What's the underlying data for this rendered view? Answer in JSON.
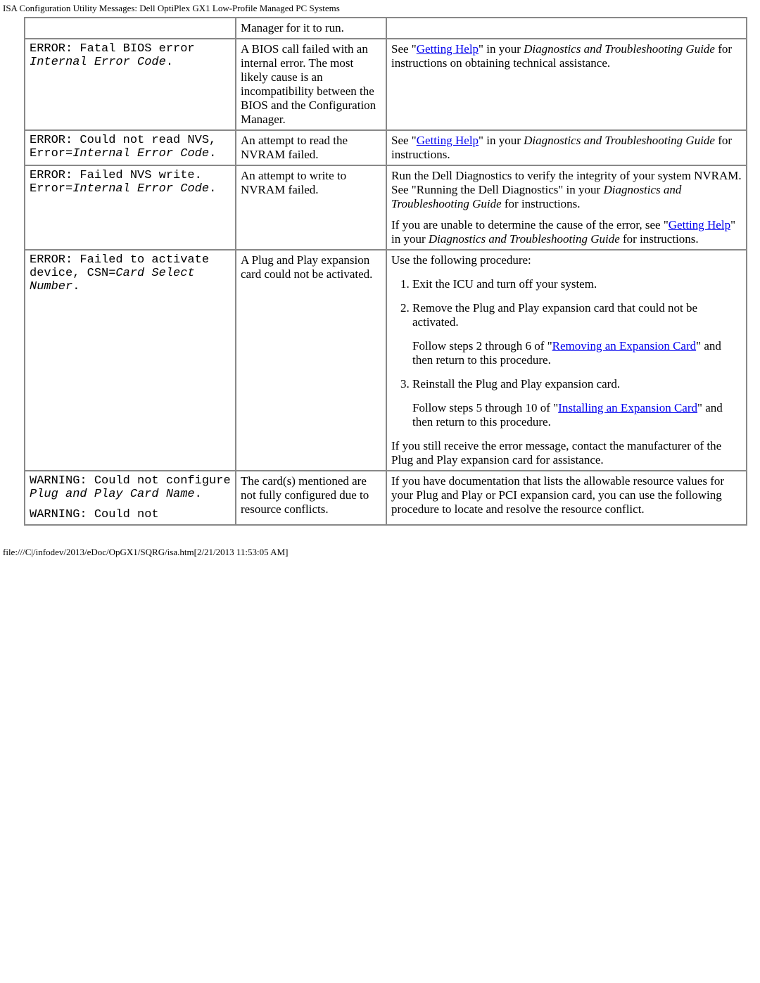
{
  "page_title": "ISA Configuration Utility Messages: Dell OptiPlex GX1 Low-Profile Managed PC Systems",
  "footer": "file:///C|/infodev/2013/eDoc/OpGX1/SQRG/isa.htm[2/21/2013 11:53:05 AM]",
  "diag_guide": "Diagnostics and Troubleshooting Guide",
  "links": {
    "getting_help": "Getting Help",
    "removing_card": "Removing an Expansion Card",
    "installing_card": "Installing an Expansion Card"
  },
  "row0": {
    "cause": "Manager for it to run."
  },
  "row1": {
    "msg_a": "ERROR: Fatal BIOS error ",
    "msg_b": "Internal Error Code",
    "msg_c": ".",
    "cause": "A BIOS call failed with an internal error. The most likely cause is an incompatibility between the BIOS and the Configuration Manager.",
    "action_a": "See \"",
    "action_b": "\" in your ",
    "action_c": " for instructions on obtaining technical assistance."
  },
  "row2": {
    "msg_a": "ERROR: Could not read NVS, Error=",
    "msg_b": "Internal Error Code",
    "msg_c": ".",
    "cause": "An attempt to read the NVRAM failed.",
    "action_a": "See \"",
    "action_b": "\" in your ",
    "action_c": " for instructions."
  },
  "row3": {
    "msg_a": "ERROR: Failed NVS write. Error=",
    "msg_b": "Internal Error Code",
    "msg_c": ".",
    "cause": "An attempt to write to NVRAM failed.",
    "p1_a": "Run the Dell Diagnostics to verify the integrity of your system NVRAM. See \"Running the Dell Diagnostics\" in your ",
    "p1_b": " for instructions.",
    "p2_a": "If you are unable to determine the cause of the error, see \"",
    "p2_b": "\" in your ",
    "p2_c": " for instructions."
  },
  "row4": {
    "msg_a": "ERROR: Failed to activate device, CSN=",
    "msg_b": "Card Select Number",
    "msg_c": ".",
    "cause": "A Plug and Play expansion card could not be activated.",
    "intro": "Use the following procedure:",
    "li1": "Exit the ICU and turn off your system.",
    "li2": "Remove the Plug and Play expansion card that could not be activated.",
    "li2_sub_a": "Follow steps 2 through 6 of \"",
    "li2_sub_b": "\" and then return to this procedure.",
    "li3": "Reinstall the Plug and Play expansion card.",
    "li3_sub_a": "Follow steps 5 through 10 of \"",
    "li3_sub_b": "\" and then return to this procedure.",
    "outro": "If you still receive the error message, contact the manufacturer of the Plug and Play expansion card for assistance."
  },
  "row5": {
    "msg1_a": "WARNING: Could not configure ",
    "msg1_b": "Plug and Play Card Name",
    "msg1_c": ".",
    "msg2": "WARNING: Could not",
    "cause": "The card(s) mentioned are not fully configured due to resource conflicts.",
    "action": "If you have documentation that lists the allowable resource values for your Plug and Play or PCI expansion card, you can use the following procedure to locate and resolve the resource conflict."
  }
}
